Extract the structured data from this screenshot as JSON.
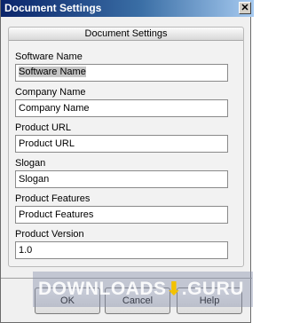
{
  "window": {
    "title": "Document Settings",
    "close_glyph": "✕"
  },
  "panel": {
    "header": "Document Settings",
    "fields": [
      {
        "label": "Software Name",
        "value": "Software Name"
      },
      {
        "label": "Company Name",
        "value": "Company Name"
      },
      {
        "label": "Product URL",
        "value": "Product URL"
      },
      {
        "label": "Slogan",
        "value": "Slogan"
      },
      {
        "label": "Product Features",
        "value": "Product Features"
      },
      {
        "label": "Product Version",
        "value": "1.0"
      }
    ]
  },
  "buttons": {
    "ok": "OK",
    "cancel": "Cancel",
    "help": "Help"
  },
  "watermark": {
    "text_left": "DOWNLOADS",
    "arrow": "⬇",
    "text_right": ".GURU"
  }
}
